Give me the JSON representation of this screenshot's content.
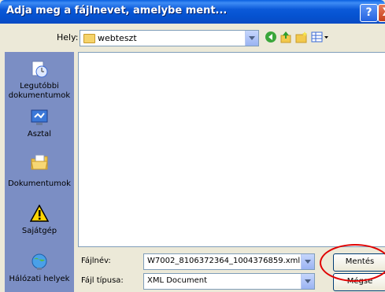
{
  "dialog": {
    "title": "Adja meg a fájlnevet, amelybe ment...",
    "help_glyph": "?",
    "close_glyph": "X"
  },
  "location": {
    "label": "Hely:",
    "value": "webteszt"
  },
  "toolbar": {
    "icons": [
      "back-icon",
      "up-folder-icon",
      "new-folder-icon",
      "views-menu-icon"
    ]
  },
  "places": [
    {
      "label": "Legutóbbi dokumentumok",
      "icon": "recent-documents-icon"
    },
    {
      "label": "Asztal",
      "icon": "desktop-icon"
    },
    {
      "label": "Dokumentumok",
      "icon": "my-documents-icon"
    },
    {
      "label": "Sajátgép",
      "icon": "my-computer-icon"
    },
    {
      "label": "Hálózati helyek",
      "icon": "network-places-icon"
    }
  ],
  "form": {
    "filename_label": "Fájlnév:",
    "filename_value": "W7002_8106372364_1004376859.xml",
    "filetype_label": "Fájl típusa:",
    "filetype_value": "XML Document",
    "save_button": "Mentés",
    "cancel_button": "Mégse"
  },
  "colors": {
    "titlebar": "#0b59d8",
    "dialog_bg": "#ece9d8",
    "places_bg": "#7b8ec4",
    "highlight_ellipse": "#e00000"
  }
}
